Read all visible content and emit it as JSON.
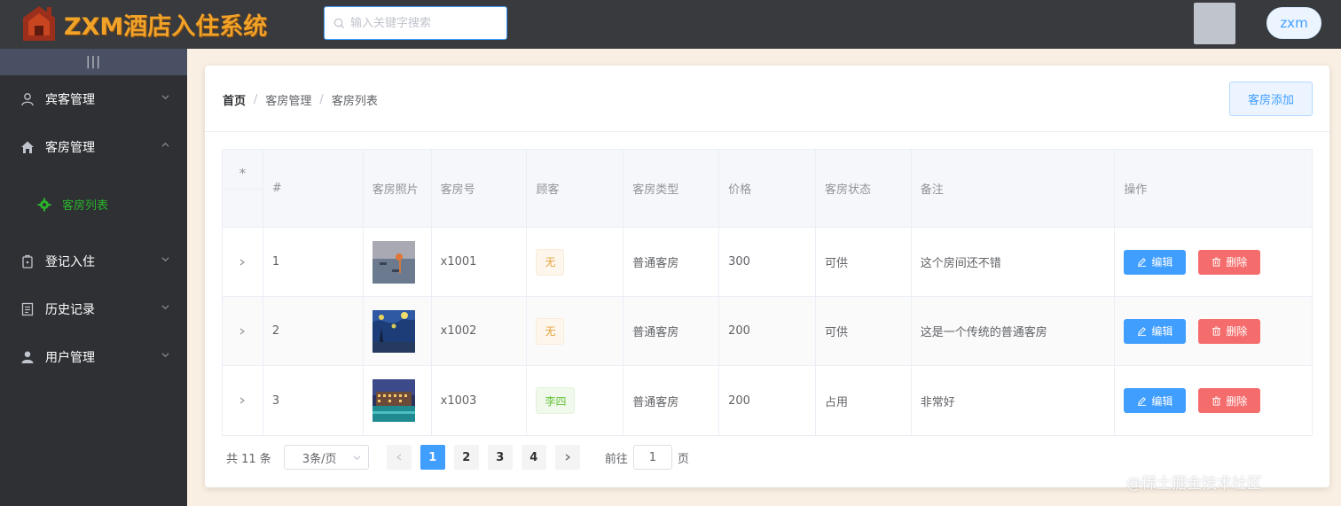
{
  "header": {
    "app_title": "ZXM酒店入住系统",
    "search_placeholder": "输入关键字搜索",
    "username": "zxm"
  },
  "sidebar": {
    "toggle_glyph": "|||",
    "items": [
      {
        "label": "宾客管理",
        "icon": "user-icon",
        "expanded": false
      },
      {
        "label": "客房管理",
        "icon": "home-icon",
        "expanded": true
      },
      {
        "label": "登记入住",
        "icon": "lock-icon",
        "expanded": false
      },
      {
        "label": "历史记录",
        "icon": "document-icon",
        "expanded": false
      },
      {
        "label": "用户管理",
        "icon": "person-icon",
        "expanded": false
      }
    ],
    "sub_items": [
      {
        "label": "客房列表",
        "icon": "gear-icon",
        "active": true
      }
    ]
  },
  "breadcrumb": [
    "首页",
    "客房管理",
    "客房列表"
  ],
  "actions": {
    "add_room": "客房添加"
  },
  "table": {
    "expand_header": "⁎",
    "columns": [
      "#",
      "客房照片",
      "客房号",
      "顾客",
      "客房类型",
      "价格",
      "客房状态",
      "备注",
      "操作"
    ],
    "rows": [
      {
        "index": "1",
        "photo": "sunrise-painting",
        "room_no": "x1001",
        "guest": "无",
        "guest_status": "warning",
        "type": "普通客房",
        "price": "300",
        "status": "可供",
        "note": "这个房间还不错"
      },
      {
        "index": "2",
        "photo": "starry-night-painting",
        "room_no": "x1002",
        "guest": "无",
        "guest_status": "warning",
        "type": "普通客房",
        "price": "200",
        "status": "可供",
        "note": "这是一个传统的普通客房"
      },
      {
        "index": "3",
        "photo": "hotel-night-photo",
        "room_no": "x1003",
        "guest": "李四",
        "guest_status": "success",
        "type": "普通客房",
        "price": "200",
        "status": "占用",
        "note": "非常好"
      }
    ],
    "edit_label": "编辑",
    "delete_label": "删除"
  },
  "pagination": {
    "total_text": "共 11 条",
    "page_size": "3条/页",
    "pages": [
      "1",
      "2",
      "3",
      "4"
    ],
    "current_page": "1",
    "goto_prefix": "前往",
    "goto_value": "1",
    "goto_suffix": "页"
  },
  "watermark": "@稀土掘金技术社区",
  "colors": {
    "primary": "#409eff",
    "danger": "#f56c6c",
    "warning": "#e6a23c",
    "success": "#67c23a",
    "sidebar_bg": "#2e3034",
    "header_bg": "#383a3d",
    "active_menu": "#2bb32b",
    "logo": "#f0a229"
  }
}
